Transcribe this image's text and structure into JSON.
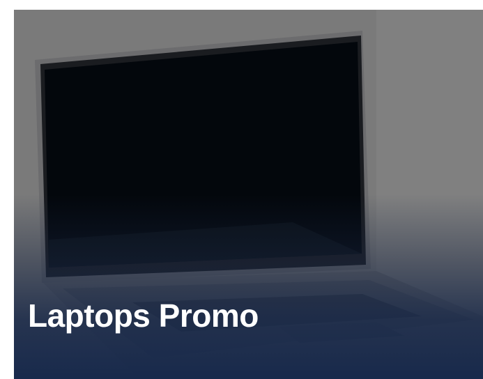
{
  "promo": {
    "title": "Laptops Promo",
    "image": "laptop-image",
    "colors": {
      "background": "#7b7b7b",
      "overlay_bottom": "#16284b",
      "text": "#ffffff"
    }
  }
}
